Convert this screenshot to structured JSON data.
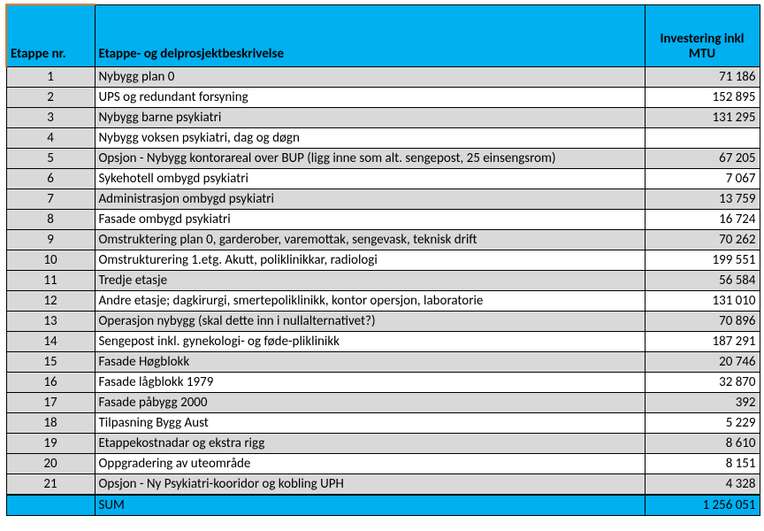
{
  "headers": {
    "col1": "Etappe nr.",
    "col2": "Etappe- og delprosjektbeskrivelse",
    "col3": "Investering inkl MTU"
  },
  "rows": [
    {
      "nr": "1",
      "desc": "Nybygg plan 0",
      "val": "71 186",
      "shade": true
    },
    {
      "nr": "2",
      "desc": "UPS og redundant forsyning",
      "val": "152 895",
      "shade": false
    },
    {
      "nr": "3",
      "desc": "Nybygg barne psykiatri",
      "val": "131 295",
      "shade": true
    },
    {
      "nr": "4",
      "desc": "Nybygg voksen psykiatri, dag og døgn",
      "val": "",
      "shade": false
    },
    {
      "nr": "5",
      "desc": "Opsjon - Nybygg kontorareal over BUP (ligg inne som alt. sengepost, 25 einsengsrom)",
      "val": "67 205",
      "shade": true
    },
    {
      "nr": "6",
      "desc": "Sykehotell ombygd psykiatri",
      "val": "7 067",
      "shade": false
    },
    {
      "nr": "7",
      "desc": "Administrasjon ombygd psykiatri",
      "val": "13 759",
      "shade": true
    },
    {
      "nr": "8",
      "desc": "Fasade ombygd psykiatri",
      "val": "16 724",
      "shade": false
    },
    {
      "nr": "9",
      "desc": "Omstruktering plan 0,  garderober, varemottak, sengevask, teknisk drift",
      "val": "70 262",
      "shade": true
    },
    {
      "nr": "10",
      "desc": "Omstrukturering 1.etg. Akutt, poliklinikkar, radiologi",
      "val": "199 551",
      "shade": false
    },
    {
      "nr": "11",
      "desc": "Tredje etasje",
      "val": "56 584",
      "shade": true
    },
    {
      "nr": "12",
      "desc": "Andre etasje; dagkirurgi, smertepoliklinikk, kontor opersjon, laboratorie",
      "val": "131 010",
      "shade": false
    },
    {
      "nr": "13",
      "desc": "Operasjon nybygg (skal dette inn i nullalternativet?)",
      "val": "70 896",
      "shade": true
    },
    {
      "nr": "14",
      "desc": "Sengepost inkl. gynekologi- og føde-pliklinikk",
      "val": "187 291",
      "shade": false
    },
    {
      "nr": "15",
      "desc": "Fasade Høgblokk",
      "val": "20 746",
      "shade": true
    },
    {
      "nr": "16",
      "desc": "Fasade lågblokk 1979",
      "val": "32 870",
      "shade": false
    },
    {
      "nr": "17",
      "desc": "Fasade påbygg 2000",
      "val": "392",
      "shade": true
    },
    {
      "nr": "18",
      "desc": "Tilpasning Bygg Aust",
      "val": "5 229",
      "shade": false
    },
    {
      "nr": "19",
      "desc": "Etappekostnadar og ekstra rigg",
      "val": "8 610",
      "shade": true
    },
    {
      "nr": "20",
      "desc": "Oppgradering av uteområde",
      "val": "8 151",
      "shade": false
    },
    {
      "nr": "21",
      "desc": "Opsjon - Ny Psykiatri-kooridor og kobling UPH",
      "val": "4 328",
      "shade": true
    }
  ],
  "sum": {
    "label": "SUM",
    "val": "1 256 051"
  },
  "chart_data": {
    "type": "table",
    "columns": [
      "Etappe nr.",
      "Etappe- og delprosjektbeskrivelse",
      "Investering inkl MTU"
    ],
    "rows": [
      [
        1,
        "Nybygg plan 0",
        71186
      ],
      [
        2,
        "UPS og redundant forsyning",
        152895
      ],
      [
        3,
        "Nybygg barne psykiatri",
        131295
      ],
      [
        4,
        "Nybygg voksen psykiatri, dag og døgn",
        null
      ],
      [
        5,
        "Opsjon - Nybygg kontorareal over BUP (ligg inne som alt. sengepost, 25 einsengsrom)",
        67205
      ],
      [
        6,
        "Sykehotell ombygd psykiatri",
        7067
      ],
      [
        7,
        "Administrasjon ombygd psykiatri",
        13759
      ],
      [
        8,
        "Fasade ombygd psykiatri",
        16724
      ],
      [
        9,
        "Omstruktering plan 0,  garderober, varemottak, sengevask, teknisk drift",
        70262
      ],
      [
        10,
        "Omstrukturering 1.etg. Akutt, poliklinikkar, radiologi",
        199551
      ],
      [
        11,
        "Tredje etasje",
        56584
      ],
      [
        12,
        "Andre etasje; dagkirurgi, smertepoliklinikk, kontor opersjon, laboratorie",
        131010
      ],
      [
        13,
        "Operasjon nybygg (skal dette inn i nullalternativet?)",
        70896
      ],
      [
        14,
        "Sengepost inkl. gynekologi- og føde-pliklinikk",
        187291
      ],
      [
        15,
        "Fasade Høgblokk",
        20746
      ],
      [
        16,
        "Fasade lågblokk 1979",
        32870
      ],
      [
        17,
        "Fasade påbygg 2000",
        392
      ],
      [
        18,
        "Tilpasning Bygg Aust",
        5229
      ],
      [
        19,
        "Etappekostnadar og ekstra rigg",
        8610
      ],
      [
        20,
        "Oppgradering av uteområde",
        8151
      ],
      [
        21,
        "Opsjon - Ny Psykiatri-kooridor og kobling UPH",
        4328
      ]
    ],
    "total": 1256051
  }
}
